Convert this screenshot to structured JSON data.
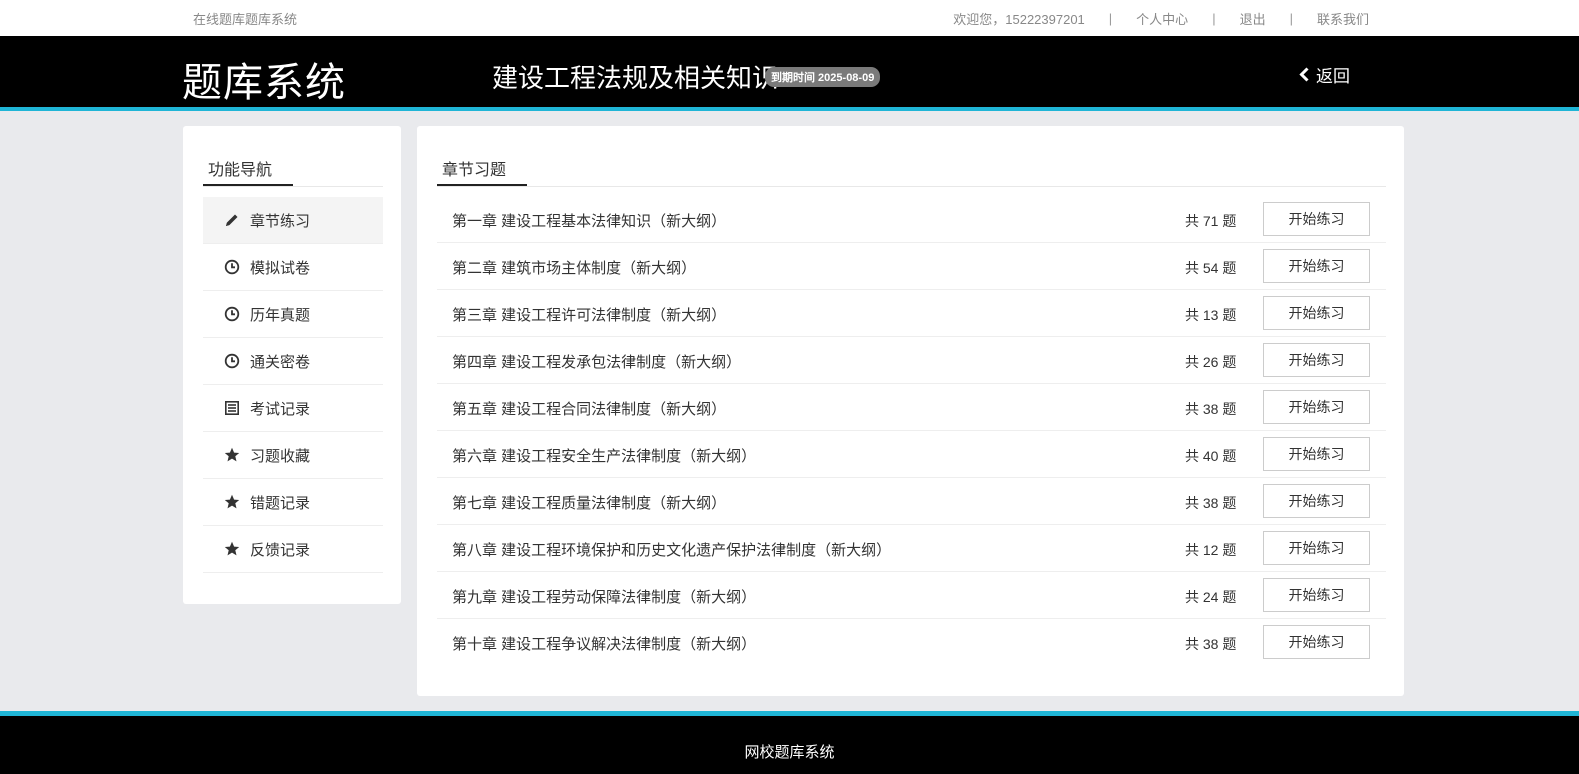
{
  "topbar": {
    "site_name": "在线题库题库系统",
    "welcome": "欢迎您，15222397201",
    "separator": "|",
    "personal_center": "个人中心",
    "logout": "退出",
    "contact": "联系我们"
  },
  "header": {
    "logo": "题库系统",
    "course": "建设工程法规及相关知识",
    "expire": "到期时间 2025-08-09",
    "back": "返回"
  },
  "sidebar": {
    "title": "功能导航",
    "items": [
      {
        "label": "章节练习",
        "icon": "pencil-icon"
      },
      {
        "label": "模拟试卷",
        "icon": "clock-icon"
      },
      {
        "label": "历年真题",
        "icon": "clock-icon"
      },
      {
        "label": "通关密卷",
        "icon": "clock-icon"
      },
      {
        "label": "考试记录",
        "icon": "list-icon"
      },
      {
        "label": "习题收藏",
        "icon": "star-icon"
      },
      {
        "label": "错题记录",
        "icon": "star-icon"
      },
      {
        "label": "反馈记录",
        "icon": "star-icon"
      }
    ]
  },
  "main": {
    "title": "章节习题",
    "button_label": "开始练习",
    "chapters": [
      {
        "name": "第一章 建设工程基本法律知识（新大纲）",
        "count": "共 71 题"
      },
      {
        "name": "第二章 建筑市场主体制度（新大纲）",
        "count": "共 54 题"
      },
      {
        "name": "第三章 建设工程许可法律制度（新大纲）",
        "count": "共 13 题"
      },
      {
        "name": "第四章 建设工程发承包法律制度（新大纲）",
        "count": "共 26 题"
      },
      {
        "name": "第五章 建设工程合同法律制度（新大纲）",
        "count": "共 38 题"
      },
      {
        "name": "第六章 建设工程安全生产法律制度（新大纲）",
        "count": "共 40 题"
      },
      {
        "name": "第七章 建设工程质量法律制度（新大纲）",
        "count": "共 38 题"
      },
      {
        "name": "第八章 建设工程环境保护和历史文化遗产保护法律制度（新大纲）",
        "count": "共 12 题"
      },
      {
        "name": "第九章 建设工程劳动保障法律制度（新大纲）",
        "count": "共 24 题"
      },
      {
        "name": "第十章 建设工程争议解决法律制度（新大纲）",
        "count": "共 38 题"
      }
    ]
  },
  "footer": {
    "text": "网校题库系统"
  },
  "colors": {
    "accent": "#1fb5d6",
    "header_bg": "#000000",
    "page_bg": "#e9eaed"
  }
}
